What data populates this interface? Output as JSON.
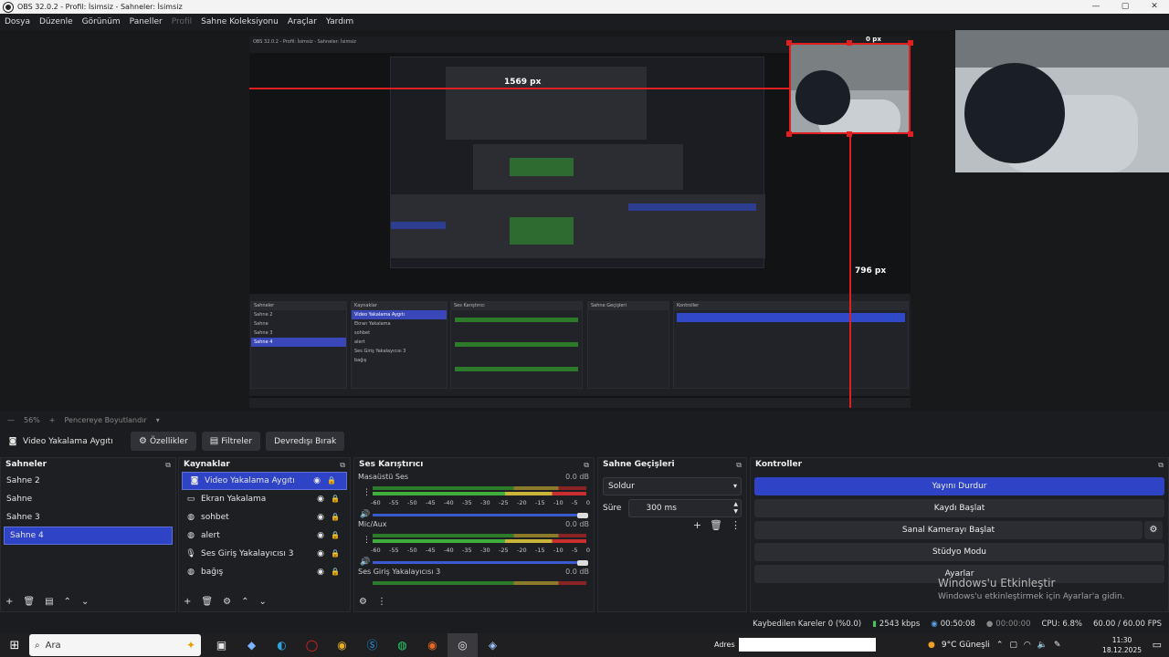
{
  "window": {
    "title": "OBS 32.0.2 - Profil: İsimsiz - Sahneler: İsimsiz",
    "controls": [
      "—",
      "▢",
      "✕"
    ]
  },
  "menu": [
    "Dosya",
    "Düzenle",
    "Görünüm",
    "Paneller",
    "Profil",
    "Sahne Koleksiyonu",
    "Araçlar",
    "Yardım"
  ],
  "preview": {
    "width_label": "1569 px",
    "height_label": "796 px",
    "height_label2": "796 px",
    "top_label": "0 px",
    "inner_title": "OBS 32.0.2 - Profil: İsimsiz - Sahneler: İsimsiz",
    "inner_scenes": [
      "Sahne 2",
      "Sahne",
      "Sahne 3",
      "Sahne 4"
    ],
    "inner_sources": [
      "Video Yakalama Aygıtı",
      "Ekran Yakalama",
      "sohbet",
      "alert",
      "Ses Giriş Yakalayıcısı 3",
      "bağış"
    ],
    "inner_controls": [
      "Yayını Durdur",
      "Kaydı Başlat",
      "Sanal Kamerayı Başlat",
      "Stüdyo Modu",
      "Ayarlar"
    ]
  },
  "zoom": {
    "percent": "56%",
    "fit_label": "Pencereye Boyutlandır"
  },
  "source_toolbar": {
    "source_name": "Video Yakalama Aygıtı",
    "properties": "Özellikler",
    "filters": "Filtreler",
    "deactivate": "Devredışı Bırak"
  },
  "scenes": {
    "title": "Sahneler",
    "items": [
      "Sahne 2",
      "Sahne",
      "Sahne 3",
      "Sahne 4"
    ],
    "selected": "Sahne 4"
  },
  "sources": {
    "title": "Kaynaklar",
    "items": [
      {
        "label": "Video Yakalama Aygıtı",
        "icon": "camera-icon"
      },
      {
        "label": "Ekran Yakalama",
        "icon": "monitor-icon"
      },
      {
        "label": "sohbet",
        "icon": "globe-icon"
      },
      {
        "label": "alert",
        "icon": "globe-icon"
      },
      {
        "label": "Ses Giriş Yakalayıcısı 3",
        "icon": "microphone-icon"
      },
      {
        "label": "bağış",
        "icon": "globe-icon"
      }
    ]
  },
  "mixer": {
    "title": "Ses Karıştırıcı",
    "channels": [
      {
        "name": "Masaüstü Ses",
        "db": "0.0 dB"
      },
      {
        "name": "Mic/Aux",
        "db": "0.0 dB"
      },
      {
        "name": "Ses Giriş Yakalayıcısı 3",
        "db": "0.0 dB"
      }
    ],
    "scale": [
      "-60",
      "-55",
      "-50",
      "-45",
      "-40",
      "-35",
      "-30",
      "-25",
      "-20",
      "-15",
      "-10",
      "-5",
      "0"
    ]
  },
  "transitions": {
    "title": "Sahne Geçişleri",
    "selected": "Soldur",
    "duration_label": "Süre",
    "duration_value": "300 ms"
  },
  "controls": {
    "title": "Kontroller",
    "stop_stream": "Yayını Durdur",
    "start_record": "Kaydı Başlat",
    "virtual_cam": "Sanal Kamerayı Başlat",
    "studio_mode": "Stüdyo Modu",
    "settings": "Ayarlar"
  },
  "watermark": {
    "line1": "Windows'u Etkinleştir",
    "line2": "Windows'u etkinleştirmek için Ayarlar'a gidin."
  },
  "status": {
    "dropped": "Kaybedilen Kareler 0 (%0.0)",
    "bitrate": "2543 kbps",
    "stream_time": "00:50:08",
    "record_time": "00:00:00",
    "cpu": "CPU: 6.8%",
    "fps": "60.00 / 60.00 FPS"
  },
  "taskbar": {
    "search_placeholder": "Ara",
    "address_label": "Adres",
    "weather": "9°C  Güneşli",
    "time": "11:30",
    "date": "18.12.2025"
  },
  "colors": {
    "accent": "#2e43c5",
    "selection_red": "#e02020"
  }
}
